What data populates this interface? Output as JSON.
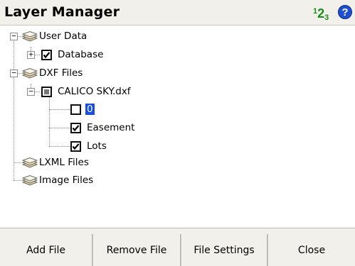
{
  "window": {
    "title": "Layer Manager",
    "numpad_icon": "numpad-icon",
    "help_icon": "help-icon",
    "help_glyph": "?",
    "accent_green": "#1a8d1a",
    "accent_blue": "#1f4fd1"
  },
  "tree": {
    "items": [
      {
        "label": "User Data",
        "icon": "layer-stack-icon",
        "expander": "−"
      },
      {
        "label": "Database",
        "checked": true,
        "expander": "+"
      },
      {
        "label": "DXF Files",
        "icon": "layer-stack-icon",
        "expander": "−"
      },
      {
        "label": "CALICO SKY.dxf",
        "checked": "partial",
        "expander": "−"
      },
      {
        "label": "0",
        "checked": false,
        "selected": true
      },
      {
        "label": "Easement",
        "checked": true
      },
      {
        "label": "Lots",
        "checked": true
      },
      {
        "label": "LXML Files",
        "icon": "layer-stack-icon"
      },
      {
        "label": "Image Files",
        "icon": "layer-stack-icon"
      }
    ],
    "selection_color": "#1a4fd8"
  },
  "buttons": {
    "add_file": "Add File",
    "remove_file": "Remove File",
    "file_settings": "File Settings",
    "close": "Close"
  }
}
